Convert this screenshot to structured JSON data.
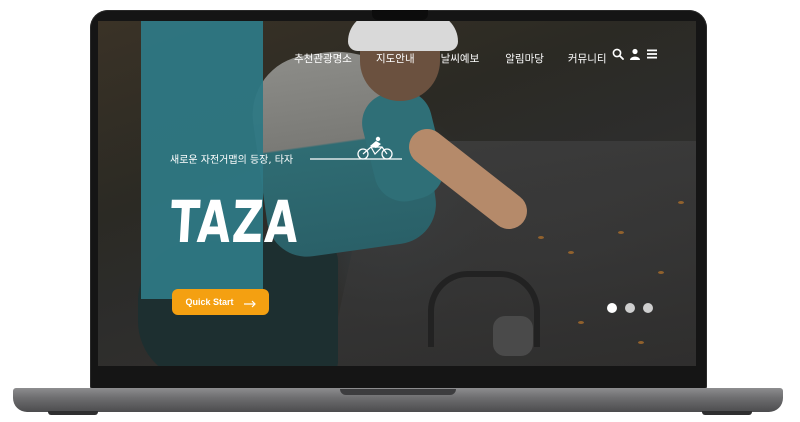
{
  "nav": {
    "items": [
      {
        "label": "추천관광명소"
      },
      {
        "label": "지도안내"
      },
      {
        "label": "날씨예보"
      },
      {
        "label": "알림마당"
      },
      {
        "label": "커뮤니티"
      }
    ],
    "icons": [
      "search-icon",
      "user-icon",
      "menu-icon"
    ]
  },
  "hero": {
    "subtitle": "새로운 자전거맵의 등장, 타자",
    "brand": "TAZA",
    "cta_label": "Quick Start"
  },
  "carousel": {
    "count": 3,
    "active_index": 0
  },
  "colors": {
    "teal": "#2e7884",
    "cta": "#f4a011",
    "frame": "#151515"
  }
}
